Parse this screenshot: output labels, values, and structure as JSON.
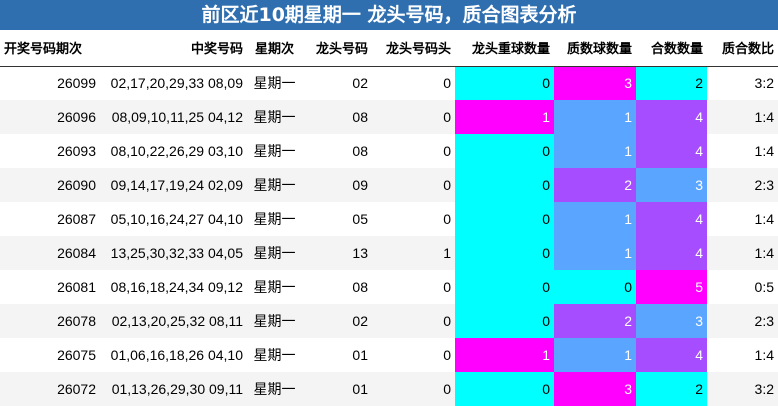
{
  "title": "前区近10期星期一 龙头号码，质合图表分析",
  "headers": [
    "开奖号码期次",
    "中奖号码",
    "星期次",
    "龙头号码",
    "龙头号码头",
    "龙头重球数量",
    "质数球数量",
    "合数数量",
    "质合数比"
  ],
  "colors": {
    "cyan": "#00ffff",
    "magenta": "#ff00ff",
    "blue": "#5aa5ff",
    "purple": "#a64dff"
  },
  "rows": [
    {
      "issue": "26099",
      "numbers": "02,17,20,29,33 08,09",
      "weekday": "星期一",
      "head_num": "02",
      "head_digit": "0",
      "repeat": "0",
      "prime": "3",
      "composite": "2",
      "ratio": "3:2",
      "c_repeat": "cyan",
      "c_prime": "magenta",
      "c_comp": "cyan"
    },
    {
      "issue": "26096",
      "numbers": "08,09,10,11,25 04,12",
      "weekday": "星期一",
      "head_num": "08",
      "head_digit": "0",
      "repeat": "1",
      "prime": "1",
      "composite": "4",
      "ratio": "1:4",
      "c_repeat": "magenta",
      "c_prime": "blue",
      "c_comp": "purple"
    },
    {
      "issue": "26093",
      "numbers": "08,10,22,26,29 03,10",
      "weekday": "星期一",
      "head_num": "08",
      "head_digit": "0",
      "repeat": "0",
      "prime": "1",
      "composite": "4",
      "ratio": "1:4",
      "c_repeat": "cyan",
      "c_prime": "blue",
      "c_comp": "purple"
    },
    {
      "issue": "26090",
      "numbers": "09,14,17,19,24 02,09",
      "weekday": "星期一",
      "head_num": "09",
      "head_digit": "0",
      "repeat": "0",
      "prime": "2",
      "composite": "3",
      "ratio": "2:3",
      "c_repeat": "cyan",
      "c_prime": "purple",
      "c_comp": "blue"
    },
    {
      "issue": "26087",
      "numbers": "05,10,16,24,27 04,10",
      "weekday": "星期一",
      "head_num": "05",
      "head_digit": "0",
      "repeat": "0",
      "prime": "1",
      "composite": "4",
      "ratio": "1:4",
      "c_repeat": "cyan",
      "c_prime": "blue",
      "c_comp": "purple"
    },
    {
      "issue": "26084",
      "numbers": "13,25,30,32,33 04,05",
      "weekday": "星期一",
      "head_num": "13",
      "head_digit": "1",
      "repeat": "0",
      "prime": "1",
      "composite": "4",
      "ratio": "1:4",
      "c_repeat": "cyan",
      "c_prime": "blue",
      "c_comp": "purple"
    },
    {
      "issue": "26081",
      "numbers": "08,16,18,24,34 09,12",
      "weekday": "星期一",
      "head_num": "08",
      "head_digit": "0",
      "repeat": "0",
      "prime": "0",
      "composite": "5",
      "ratio": "0:5",
      "c_repeat": "cyan",
      "c_prime": "cyan",
      "c_comp": "magenta"
    },
    {
      "issue": "26078",
      "numbers": "02,13,20,25,32 08,11",
      "weekday": "星期一",
      "head_num": "02",
      "head_digit": "0",
      "repeat": "0",
      "prime": "2",
      "composite": "3",
      "ratio": "2:3",
      "c_repeat": "cyan",
      "c_prime": "purple",
      "c_comp": "blue"
    },
    {
      "issue": "26075",
      "numbers": "01,06,16,18,26 04,10",
      "weekday": "星期一",
      "head_num": "01",
      "head_digit": "0",
      "repeat": "1",
      "prime": "1",
      "composite": "4",
      "ratio": "1:4",
      "c_repeat": "magenta",
      "c_prime": "blue",
      "c_comp": "purple"
    },
    {
      "issue": "26072",
      "numbers": "01,13,26,29,30 09,11",
      "weekday": "星期一",
      "head_num": "01",
      "head_digit": "0",
      "repeat": "0",
      "prime": "3",
      "composite": "2",
      "ratio": "3:2",
      "c_repeat": "cyan",
      "c_prime": "magenta",
      "c_comp": "cyan"
    }
  ]
}
